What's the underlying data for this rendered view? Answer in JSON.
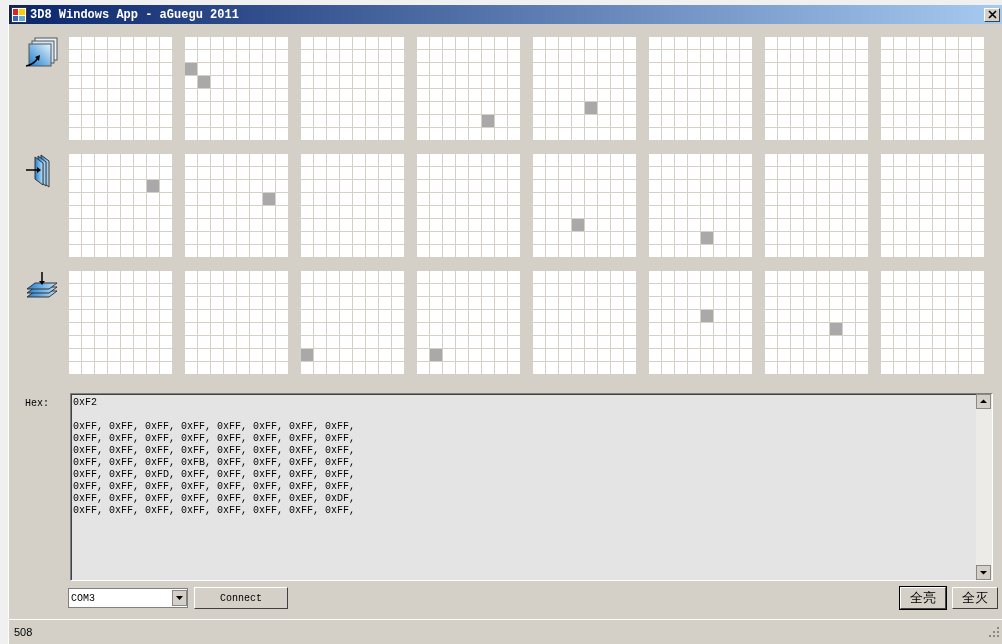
{
  "window": {
    "title": "3D8 Windows App - aGuegu 2011"
  },
  "panels": [
    {
      "kind": "front",
      "grids": [
        [
          [
            false,
            false,
            false,
            false,
            false,
            false,
            false,
            false
          ],
          [
            false,
            false,
            false,
            false,
            false,
            false,
            false,
            false
          ],
          [
            false,
            false,
            false,
            false,
            false,
            false,
            false,
            false
          ],
          [
            false,
            false,
            false,
            false,
            false,
            false,
            false,
            false
          ],
          [
            false,
            false,
            false,
            false,
            false,
            false,
            false,
            false
          ],
          [
            false,
            false,
            false,
            false,
            false,
            false,
            false,
            false
          ],
          [
            false,
            false,
            false,
            false,
            false,
            false,
            false,
            false
          ],
          [
            false,
            false,
            false,
            false,
            false,
            false,
            false,
            false
          ]
        ],
        [
          [
            false,
            false,
            false,
            false,
            false,
            false,
            false,
            false
          ],
          [
            false,
            false,
            false,
            false,
            false,
            false,
            false,
            false
          ],
          [
            true,
            false,
            false,
            false,
            false,
            false,
            false,
            false
          ],
          [
            false,
            true,
            false,
            false,
            false,
            false,
            false,
            false
          ],
          [
            false,
            false,
            false,
            false,
            false,
            false,
            false,
            false
          ],
          [
            false,
            false,
            false,
            false,
            false,
            false,
            false,
            false
          ],
          [
            false,
            false,
            false,
            false,
            false,
            false,
            false,
            false
          ],
          [
            false,
            false,
            false,
            false,
            false,
            false,
            false,
            false
          ]
        ],
        [
          [
            false,
            false,
            false,
            false,
            false,
            false,
            false,
            false
          ],
          [
            false,
            false,
            false,
            false,
            false,
            false,
            false,
            false
          ],
          [
            false,
            false,
            false,
            false,
            false,
            false,
            false,
            false
          ],
          [
            false,
            false,
            false,
            false,
            false,
            false,
            false,
            false
          ],
          [
            false,
            false,
            false,
            false,
            false,
            false,
            false,
            false
          ],
          [
            false,
            false,
            false,
            false,
            false,
            false,
            false,
            false
          ],
          [
            false,
            false,
            false,
            false,
            false,
            false,
            false,
            false
          ],
          [
            false,
            false,
            false,
            false,
            false,
            false,
            false,
            false
          ]
        ],
        [
          [
            false,
            false,
            false,
            false,
            false,
            false,
            false,
            false
          ],
          [
            false,
            false,
            false,
            false,
            false,
            false,
            false,
            false
          ],
          [
            false,
            false,
            false,
            false,
            false,
            false,
            false,
            false
          ],
          [
            false,
            false,
            false,
            false,
            false,
            false,
            false,
            false
          ],
          [
            false,
            false,
            false,
            false,
            false,
            false,
            false,
            false
          ],
          [
            false,
            false,
            false,
            false,
            false,
            false,
            false,
            false
          ],
          [
            false,
            false,
            false,
            false,
            false,
            true,
            false,
            false
          ],
          [
            false,
            false,
            false,
            false,
            false,
            false,
            false,
            false
          ]
        ],
        [
          [
            false,
            false,
            false,
            false,
            false,
            false,
            false,
            false
          ],
          [
            false,
            false,
            false,
            false,
            false,
            false,
            false,
            false
          ],
          [
            false,
            false,
            false,
            false,
            false,
            false,
            false,
            false
          ],
          [
            false,
            false,
            false,
            false,
            false,
            false,
            false,
            false
          ],
          [
            false,
            false,
            false,
            false,
            false,
            false,
            false,
            false
          ],
          [
            false,
            false,
            false,
            false,
            true,
            false,
            false,
            false
          ],
          [
            false,
            false,
            false,
            false,
            false,
            false,
            false,
            false
          ],
          [
            false,
            false,
            false,
            false,
            false,
            false,
            false,
            false
          ]
        ],
        [
          [
            false,
            false,
            false,
            false,
            false,
            false,
            false,
            false
          ],
          [
            false,
            false,
            false,
            false,
            false,
            false,
            false,
            false
          ],
          [
            false,
            false,
            false,
            false,
            false,
            false,
            false,
            false
          ],
          [
            false,
            false,
            false,
            false,
            false,
            false,
            false,
            false
          ],
          [
            false,
            false,
            false,
            false,
            false,
            false,
            false,
            false
          ],
          [
            false,
            false,
            false,
            false,
            false,
            false,
            false,
            false
          ],
          [
            false,
            false,
            false,
            false,
            false,
            false,
            false,
            false
          ],
          [
            false,
            false,
            false,
            false,
            false,
            false,
            false,
            false
          ]
        ],
        [
          [
            false,
            false,
            false,
            false,
            false,
            false,
            false,
            false
          ],
          [
            false,
            false,
            false,
            false,
            false,
            false,
            false,
            false
          ],
          [
            false,
            false,
            false,
            false,
            false,
            false,
            false,
            false
          ],
          [
            false,
            false,
            false,
            false,
            false,
            false,
            false,
            false
          ],
          [
            false,
            false,
            false,
            false,
            false,
            false,
            false,
            false
          ],
          [
            false,
            false,
            false,
            false,
            false,
            false,
            false,
            false
          ],
          [
            false,
            false,
            false,
            false,
            false,
            false,
            false,
            false
          ],
          [
            false,
            false,
            false,
            false,
            false,
            false,
            false,
            false
          ]
        ],
        [
          [
            false,
            false,
            false,
            false,
            false,
            false,
            false,
            false
          ],
          [
            false,
            false,
            false,
            false,
            false,
            false,
            false,
            false
          ],
          [
            false,
            false,
            false,
            false,
            false,
            false,
            false,
            false
          ],
          [
            false,
            false,
            false,
            false,
            false,
            false,
            false,
            false
          ],
          [
            false,
            false,
            false,
            false,
            false,
            false,
            false,
            false
          ],
          [
            false,
            false,
            false,
            false,
            false,
            false,
            false,
            false
          ],
          [
            false,
            false,
            false,
            false,
            false,
            false,
            false,
            false
          ],
          [
            false,
            false,
            false,
            false,
            false,
            false,
            false,
            false
          ]
        ]
      ]
    },
    {
      "kind": "side",
      "grids": [
        [
          [
            false,
            false,
            false,
            false,
            false,
            false,
            false,
            false
          ],
          [
            false,
            false,
            false,
            false,
            false,
            false,
            false,
            false
          ],
          [
            false,
            false,
            false,
            false,
            false,
            false,
            true,
            false
          ],
          [
            false,
            false,
            false,
            false,
            false,
            false,
            false,
            false
          ],
          [
            false,
            false,
            false,
            false,
            false,
            false,
            false,
            false
          ],
          [
            false,
            false,
            false,
            false,
            false,
            false,
            false,
            false
          ],
          [
            false,
            false,
            false,
            false,
            false,
            false,
            false,
            false
          ],
          [
            false,
            false,
            false,
            false,
            false,
            false,
            false,
            false
          ]
        ],
        [
          [
            false,
            false,
            false,
            false,
            false,
            false,
            false,
            false
          ],
          [
            false,
            false,
            false,
            false,
            false,
            false,
            false,
            false
          ],
          [
            false,
            false,
            false,
            false,
            false,
            false,
            false,
            false
          ],
          [
            false,
            false,
            false,
            false,
            false,
            false,
            true,
            false
          ],
          [
            false,
            false,
            false,
            false,
            false,
            false,
            false,
            false
          ],
          [
            false,
            false,
            false,
            false,
            false,
            false,
            false,
            false
          ],
          [
            false,
            false,
            false,
            false,
            false,
            false,
            false,
            false
          ],
          [
            false,
            false,
            false,
            false,
            false,
            false,
            false,
            false
          ]
        ],
        [
          [
            false,
            false,
            false,
            false,
            false,
            false,
            false,
            false
          ],
          [
            false,
            false,
            false,
            false,
            false,
            false,
            false,
            false
          ],
          [
            false,
            false,
            false,
            false,
            false,
            false,
            false,
            false
          ],
          [
            false,
            false,
            false,
            false,
            false,
            false,
            false,
            false
          ],
          [
            false,
            false,
            false,
            false,
            false,
            false,
            false,
            false
          ],
          [
            false,
            false,
            false,
            false,
            false,
            false,
            false,
            false
          ],
          [
            false,
            false,
            false,
            false,
            false,
            false,
            false,
            false
          ],
          [
            false,
            false,
            false,
            false,
            false,
            false,
            false,
            false
          ]
        ],
        [
          [
            false,
            false,
            false,
            false,
            false,
            false,
            false,
            false
          ],
          [
            false,
            false,
            false,
            false,
            false,
            false,
            false,
            false
          ],
          [
            false,
            false,
            false,
            false,
            false,
            false,
            false,
            false
          ],
          [
            false,
            false,
            false,
            false,
            false,
            false,
            false,
            false
          ],
          [
            false,
            false,
            false,
            false,
            false,
            false,
            false,
            false
          ],
          [
            false,
            false,
            false,
            false,
            false,
            false,
            false,
            false
          ],
          [
            false,
            false,
            false,
            false,
            false,
            false,
            false,
            false
          ],
          [
            false,
            false,
            false,
            false,
            false,
            false,
            false,
            false
          ]
        ],
        [
          [
            false,
            false,
            false,
            false,
            false,
            false,
            false,
            false
          ],
          [
            false,
            false,
            false,
            false,
            false,
            false,
            false,
            false
          ],
          [
            false,
            false,
            false,
            false,
            false,
            false,
            false,
            false
          ],
          [
            false,
            false,
            false,
            false,
            false,
            false,
            false,
            false
          ],
          [
            false,
            false,
            false,
            false,
            false,
            false,
            false,
            false
          ],
          [
            false,
            false,
            false,
            true,
            false,
            false,
            false,
            false
          ],
          [
            false,
            false,
            false,
            false,
            false,
            false,
            false,
            false
          ],
          [
            false,
            false,
            false,
            false,
            false,
            false,
            false,
            false
          ]
        ],
        [
          [
            false,
            false,
            false,
            false,
            false,
            false,
            false,
            false
          ],
          [
            false,
            false,
            false,
            false,
            false,
            false,
            false,
            false
          ],
          [
            false,
            false,
            false,
            false,
            false,
            false,
            false,
            false
          ],
          [
            false,
            false,
            false,
            false,
            false,
            false,
            false,
            false
          ],
          [
            false,
            false,
            false,
            false,
            false,
            false,
            false,
            false
          ],
          [
            false,
            false,
            false,
            false,
            false,
            false,
            false,
            false
          ],
          [
            false,
            false,
            false,
            false,
            true,
            false,
            false,
            false
          ],
          [
            false,
            false,
            false,
            false,
            false,
            false,
            false,
            false
          ]
        ],
        [
          [
            false,
            false,
            false,
            false,
            false,
            false,
            false,
            false
          ],
          [
            false,
            false,
            false,
            false,
            false,
            false,
            false,
            false
          ],
          [
            false,
            false,
            false,
            false,
            false,
            false,
            false,
            false
          ],
          [
            false,
            false,
            false,
            false,
            false,
            false,
            false,
            false
          ],
          [
            false,
            false,
            false,
            false,
            false,
            false,
            false,
            false
          ],
          [
            false,
            false,
            false,
            false,
            false,
            false,
            false,
            false
          ],
          [
            false,
            false,
            false,
            false,
            false,
            false,
            false,
            false
          ],
          [
            false,
            false,
            false,
            false,
            false,
            false,
            false,
            false
          ]
        ],
        [
          [
            false,
            false,
            false,
            false,
            false,
            false,
            false,
            false
          ],
          [
            false,
            false,
            false,
            false,
            false,
            false,
            false,
            false
          ],
          [
            false,
            false,
            false,
            false,
            false,
            false,
            false,
            false
          ],
          [
            false,
            false,
            false,
            false,
            false,
            false,
            false,
            false
          ],
          [
            false,
            false,
            false,
            false,
            false,
            false,
            false,
            false
          ],
          [
            false,
            false,
            false,
            false,
            false,
            false,
            false,
            false
          ],
          [
            false,
            false,
            false,
            false,
            false,
            false,
            false,
            false
          ],
          [
            false,
            false,
            false,
            false,
            false,
            false,
            false,
            false
          ]
        ]
      ]
    },
    {
      "kind": "top",
      "grids": [
        [
          [
            false,
            false,
            false,
            false,
            false,
            false,
            false,
            false
          ],
          [
            false,
            false,
            false,
            false,
            false,
            false,
            false,
            false
          ],
          [
            false,
            false,
            false,
            false,
            false,
            false,
            false,
            false
          ],
          [
            false,
            false,
            false,
            false,
            false,
            false,
            false,
            false
          ],
          [
            false,
            false,
            false,
            false,
            false,
            false,
            false,
            false
          ],
          [
            false,
            false,
            false,
            false,
            false,
            false,
            false,
            false
          ],
          [
            false,
            false,
            false,
            false,
            false,
            false,
            false,
            false
          ],
          [
            false,
            false,
            false,
            false,
            false,
            false,
            false,
            false
          ]
        ],
        [
          [
            false,
            false,
            false,
            false,
            false,
            false,
            false,
            false
          ],
          [
            false,
            false,
            false,
            false,
            false,
            false,
            false,
            false
          ],
          [
            false,
            false,
            false,
            false,
            false,
            false,
            false,
            false
          ],
          [
            false,
            false,
            false,
            false,
            false,
            false,
            false,
            false
          ],
          [
            false,
            false,
            false,
            false,
            false,
            false,
            false,
            false
          ],
          [
            false,
            false,
            false,
            false,
            false,
            false,
            false,
            false
          ],
          [
            false,
            false,
            false,
            false,
            false,
            false,
            false,
            false
          ],
          [
            false,
            false,
            false,
            false,
            false,
            false,
            false,
            false
          ]
        ],
        [
          [
            false,
            false,
            false,
            false,
            false,
            false,
            false,
            false
          ],
          [
            false,
            false,
            false,
            false,
            false,
            false,
            false,
            false
          ],
          [
            false,
            false,
            false,
            false,
            false,
            false,
            false,
            false
          ],
          [
            false,
            false,
            false,
            false,
            false,
            false,
            false,
            false
          ],
          [
            false,
            false,
            false,
            false,
            false,
            false,
            false,
            false
          ],
          [
            false,
            false,
            false,
            false,
            false,
            false,
            false,
            false
          ],
          [
            true,
            false,
            false,
            false,
            false,
            false,
            false,
            false
          ],
          [
            false,
            false,
            false,
            false,
            false,
            false,
            false,
            false
          ]
        ],
        [
          [
            false,
            false,
            false,
            false,
            false,
            false,
            false,
            false
          ],
          [
            false,
            false,
            false,
            false,
            false,
            false,
            false,
            false
          ],
          [
            false,
            false,
            false,
            false,
            false,
            false,
            false,
            false
          ],
          [
            false,
            false,
            false,
            false,
            false,
            false,
            false,
            false
          ],
          [
            false,
            false,
            false,
            false,
            false,
            false,
            false,
            false
          ],
          [
            false,
            false,
            false,
            false,
            false,
            false,
            false,
            false
          ],
          [
            false,
            true,
            false,
            false,
            false,
            false,
            false,
            false
          ],
          [
            false,
            false,
            false,
            false,
            false,
            false,
            false,
            false
          ]
        ],
        [
          [
            false,
            false,
            false,
            false,
            false,
            false,
            false,
            false
          ],
          [
            false,
            false,
            false,
            false,
            false,
            false,
            false,
            false
          ],
          [
            false,
            false,
            false,
            false,
            false,
            false,
            false,
            false
          ],
          [
            false,
            false,
            false,
            false,
            false,
            false,
            false,
            false
          ],
          [
            false,
            false,
            false,
            false,
            false,
            false,
            false,
            false
          ],
          [
            false,
            false,
            false,
            false,
            false,
            false,
            false,
            false
          ],
          [
            false,
            false,
            false,
            false,
            false,
            false,
            false,
            false
          ],
          [
            false,
            false,
            false,
            false,
            false,
            false,
            false,
            false
          ]
        ],
        [
          [
            false,
            false,
            false,
            false,
            false,
            false,
            false,
            false
          ],
          [
            false,
            false,
            false,
            false,
            false,
            false,
            false,
            false
          ],
          [
            false,
            false,
            false,
            false,
            false,
            false,
            false,
            false
          ],
          [
            false,
            false,
            false,
            false,
            true,
            false,
            false,
            false
          ],
          [
            false,
            false,
            false,
            false,
            false,
            false,
            false,
            false
          ],
          [
            false,
            false,
            false,
            false,
            false,
            false,
            false,
            false
          ],
          [
            false,
            false,
            false,
            false,
            false,
            false,
            false,
            false
          ],
          [
            false,
            false,
            false,
            false,
            false,
            false,
            false,
            false
          ]
        ],
        [
          [
            false,
            false,
            false,
            false,
            false,
            false,
            false,
            false
          ],
          [
            false,
            false,
            false,
            false,
            false,
            false,
            false,
            false
          ],
          [
            false,
            false,
            false,
            false,
            false,
            false,
            false,
            false
          ],
          [
            false,
            false,
            false,
            false,
            false,
            false,
            false,
            false
          ],
          [
            false,
            false,
            false,
            false,
            false,
            true,
            false,
            false
          ],
          [
            false,
            false,
            false,
            false,
            false,
            false,
            false,
            false
          ],
          [
            false,
            false,
            false,
            false,
            false,
            false,
            false,
            false
          ],
          [
            false,
            false,
            false,
            false,
            false,
            false,
            false,
            false
          ]
        ],
        [
          [
            false,
            false,
            false,
            false,
            false,
            false,
            false,
            false
          ],
          [
            false,
            false,
            false,
            false,
            false,
            false,
            false,
            false
          ],
          [
            false,
            false,
            false,
            false,
            false,
            false,
            false,
            false
          ],
          [
            false,
            false,
            false,
            false,
            false,
            false,
            false,
            false
          ],
          [
            false,
            false,
            false,
            false,
            false,
            false,
            false,
            false
          ],
          [
            false,
            false,
            false,
            false,
            false,
            false,
            false,
            false
          ],
          [
            false,
            false,
            false,
            false,
            false,
            false,
            false,
            false
          ],
          [
            false,
            false,
            false,
            false,
            false,
            false,
            false,
            false
          ]
        ]
      ]
    }
  ],
  "hex": {
    "label": "Hex:",
    "value": "0xF2\n\n0xFF, 0xFF, 0xFF, 0xFF, 0xFF, 0xFF, 0xFF, 0xFF,\n0xFF, 0xFF, 0xFF, 0xFF, 0xFF, 0xFF, 0xFF, 0xFF,\n0xFF, 0xFF, 0xFF, 0xFF, 0xFF, 0xFF, 0xFF, 0xFF,\n0xFF, 0xFF, 0xFF, 0xFB, 0xFF, 0xFF, 0xFF, 0xFF,\n0xFF, 0xFF, 0xFD, 0xFF, 0xFF, 0xFF, 0xFF, 0xFF,\n0xFF, 0xFF, 0xFF, 0xFF, 0xFF, 0xFF, 0xFF, 0xFF,\n0xFF, 0xFF, 0xFF, 0xFF, 0xFF, 0xFF, 0xEF, 0xDF,\n0xFF, 0xFF, 0xFF, 0xFF, 0xFF, 0xFF, 0xFF, 0xFF,"
  },
  "port": {
    "value": "COM3"
  },
  "connect_button": "Connect",
  "buttons": [
    {
      "label": "全亮",
      "selected": true
    },
    {
      "label": "全灭",
      "selected": false
    }
  ],
  "status_bar": "508"
}
